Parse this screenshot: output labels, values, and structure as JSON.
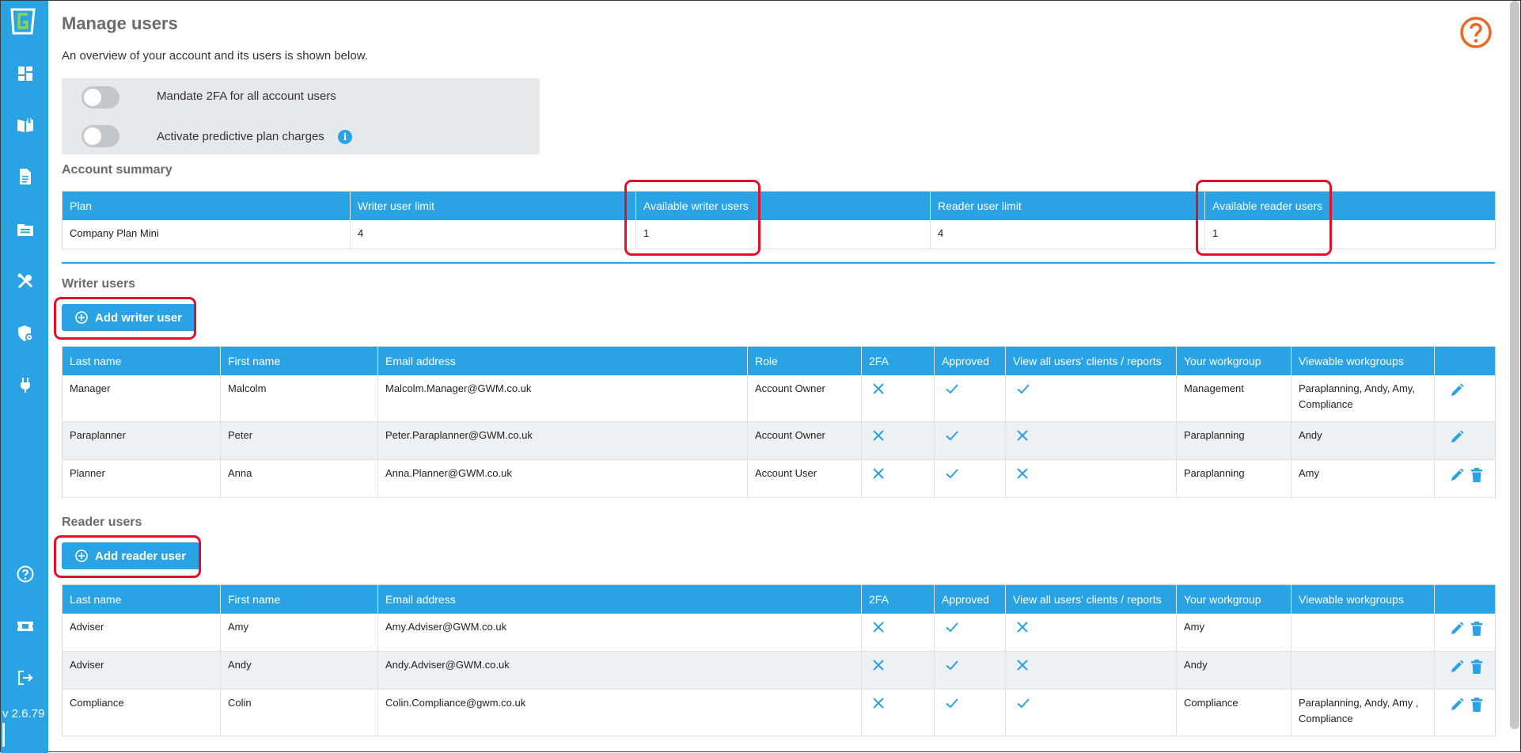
{
  "app": {
    "version": "v 2.6.79"
  },
  "sidebar": {
    "items": [
      {
        "icon": "dashboard-icon"
      },
      {
        "icon": "book-open-icon"
      },
      {
        "icon": "document-icon"
      },
      {
        "icon": "folder-icon"
      },
      {
        "icon": "tools-icon"
      },
      {
        "icon": "shield-gear-icon"
      },
      {
        "icon": "plug-icon"
      }
    ],
    "bottom_items": [
      {
        "icon": "help-circle-icon"
      },
      {
        "icon": "ticket-icon"
      },
      {
        "icon": "logout-icon"
      }
    ]
  },
  "page": {
    "title": "Manage users",
    "intro": "An overview of your account and its users is shown below."
  },
  "settings": {
    "mandate_2fa_label": "Mandate 2FA for all account users",
    "predictive_label": "Activate predictive plan charges"
  },
  "account_summary": {
    "title": "Account summary",
    "headers": [
      "Plan",
      "Writer user limit",
      "Available writer users",
      "Reader user limit",
      "Available reader users"
    ],
    "row": [
      "Company Plan Mini",
      "4",
      "1",
      "4",
      "1"
    ]
  },
  "writer_users": {
    "title": "Writer users",
    "add_button": "Add writer user",
    "headers": [
      "Last name",
      "First name",
      "Email address",
      "Role",
      "2FA",
      "Approved",
      "View all users' clients / reports",
      "Your workgroup",
      "Viewable workgroups",
      ""
    ],
    "rows": [
      {
        "last": "Manager",
        "first": "Malcolm",
        "email": "Malcolm.Manager@GWM.co.uk",
        "role": "Account Owner",
        "twofa": false,
        "approved": true,
        "view_all": true,
        "workgroup": "Management",
        "viewable": "Paraplanning, Andy, Amy, Compliance",
        "can_delete": false
      },
      {
        "last": "Paraplanner",
        "first": "Peter",
        "email": "Peter.Paraplanner@GWM.co.uk",
        "role": "Account Owner",
        "twofa": false,
        "approved": true,
        "view_all": false,
        "workgroup": "Paraplanning",
        "viewable": "Andy",
        "can_delete": false
      },
      {
        "last": "Planner",
        "first": "Anna",
        "email": "Anna.Planner@GWM.co.uk",
        "role": "Account User",
        "twofa": false,
        "approved": true,
        "view_all": false,
        "workgroup": "Paraplanning",
        "viewable": "Amy",
        "can_delete": true
      }
    ]
  },
  "reader_users": {
    "title": "Reader users",
    "add_button": "Add reader user",
    "headers": [
      "Last name",
      "First name",
      "Email address",
      "2FA",
      "Approved",
      "View all users' clients / reports",
      "Your workgroup",
      "Viewable workgroups",
      ""
    ],
    "rows": [
      {
        "last": "Adviser",
        "first": "Amy",
        "email": "Amy.Adviser@GWM.co.uk",
        "twofa": false,
        "approved": true,
        "view_all": false,
        "workgroup": "Amy",
        "viewable": "",
        "can_delete": true
      },
      {
        "last": "Adviser",
        "first": "Andy",
        "email": "Andy.Adviser@GWM.co.uk",
        "twofa": false,
        "approved": true,
        "view_all": false,
        "workgroup": "Andy",
        "viewable": "",
        "can_delete": true
      },
      {
        "last": "Compliance",
        "first": "Colin",
        "email": "Colin.Compliance@gwm.co.uk",
        "twofa": false,
        "approved": true,
        "view_all": true,
        "workgroup": "Compliance",
        "viewable": "Paraplanning, Andy, Amy , Compliance",
        "can_delete": true
      }
    ]
  },
  "colors": {
    "accent": "#29a3e3",
    "highlight": "#e3102c",
    "help": "#ea6a25"
  }
}
